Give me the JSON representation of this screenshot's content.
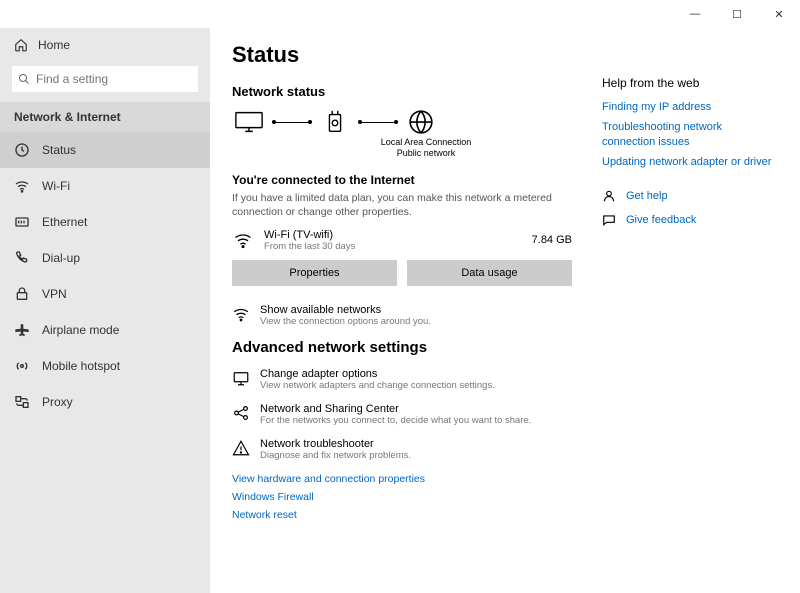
{
  "window": {
    "minimize": "—",
    "maximize": "☐",
    "close": "✕"
  },
  "sidebar": {
    "home": "Home",
    "search_placeholder": "Find a setting",
    "section": "Network & Internet",
    "items": [
      {
        "label": "Status"
      },
      {
        "label": "Wi-Fi"
      },
      {
        "label": "Ethernet"
      },
      {
        "label": "Dial-up"
      },
      {
        "label": "VPN"
      },
      {
        "label": "Airplane mode"
      },
      {
        "label": "Mobile hotspot"
      },
      {
        "label": "Proxy"
      }
    ]
  },
  "main": {
    "title": "Status",
    "subtitle": "Network status",
    "diagram": {
      "line1": "Local Area Connection",
      "line2": "Public network"
    },
    "connected_heading": "You're connected to the Internet",
    "connected_desc": "If you have a limited data plan, you can make this network a metered connection or change other properties.",
    "connection": {
      "name": "Wi-Fi (TV-wifi)",
      "sub": "From the last 30 days",
      "usage": "7.84 GB"
    },
    "buttons": {
      "properties": "Properties",
      "data_usage": "Data usage"
    },
    "show_networks": {
      "title": "Show available networks",
      "sub": "View the connection options around you."
    },
    "advanced_heading": "Advanced network settings",
    "advanced": [
      {
        "title": "Change adapter options",
        "sub": "View network adapters and change connection settings."
      },
      {
        "title": "Network and Sharing Center",
        "sub": "For the networks you connect to, decide what you want to share."
      },
      {
        "title": "Network troubleshooter",
        "sub": "Diagnose and fix network problems."
      }
    ],
    "links": [
      "View hardware and connection properties",
      "Windows Firewall",
      "Network reset"
    ]
  },
  "right": {
    "heading": "Help from the web",
    "links": [
      "Finding my IP address",
      "Troubleshooting network connection issues",
      "Updating network adapter or driver"
    ],
    "get_help": "Get help",
    "feedback": "Give feedback"
  }
}
